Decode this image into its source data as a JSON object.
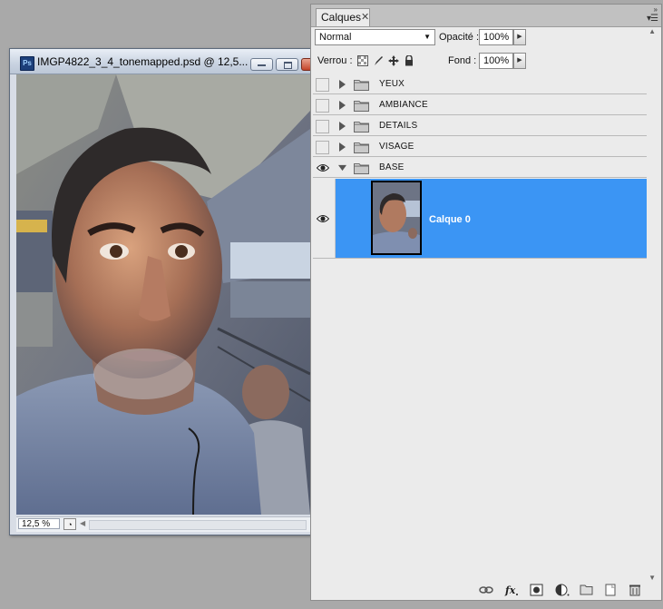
{
  "document": {
    "title": "IMGP4822_3_4_tonemapped.psd @ 12,5...",
    "app_badge": "Ps",
    "zoom": "12,5 %"
  },
  "layers_panel": {
    "tab_label": "Calques",
    "blend_mode": "Normal",
    "opacity_label": "Opacité :",
    "opacity_value": "100%",
    "lock_label": "Verrou :",
    "fill_label": "Fond :",
    "fill_value": "100%",
    "groups": [
      {
        "name": "YEUX",
        "visible": false,
        "expanded": false
      },
      {
        "name": "AMBIANCE",
        "visible": false,
        "expanded": false
      },
      {
        "name": "DETAILS",
        "visible": false,
        "expanded": false
      },
      {
        "name": "VISAGE",
        "visible": false,
        "expanded": false
      },
      {
        "name": "BASE",
        "visible": true,
        "expanded": true
      }
    ],
    "layer": {
      "name": "Calque 0",
      "visible": true,
      "selected": true
    },
    "footer_icons": [
      "link-icon",
      "fx-icon",
      "mask-icon",
      "adjustment-icon",
      "group-icon",
      "new-layer-icon",
      "trash-icon"
    ]
  },
  "colors": {
    "selection": "#3b95f4",
    "panel_bg": "#ebebeb",
    "desktop_bg": "#a9a9a9"
  }
}
